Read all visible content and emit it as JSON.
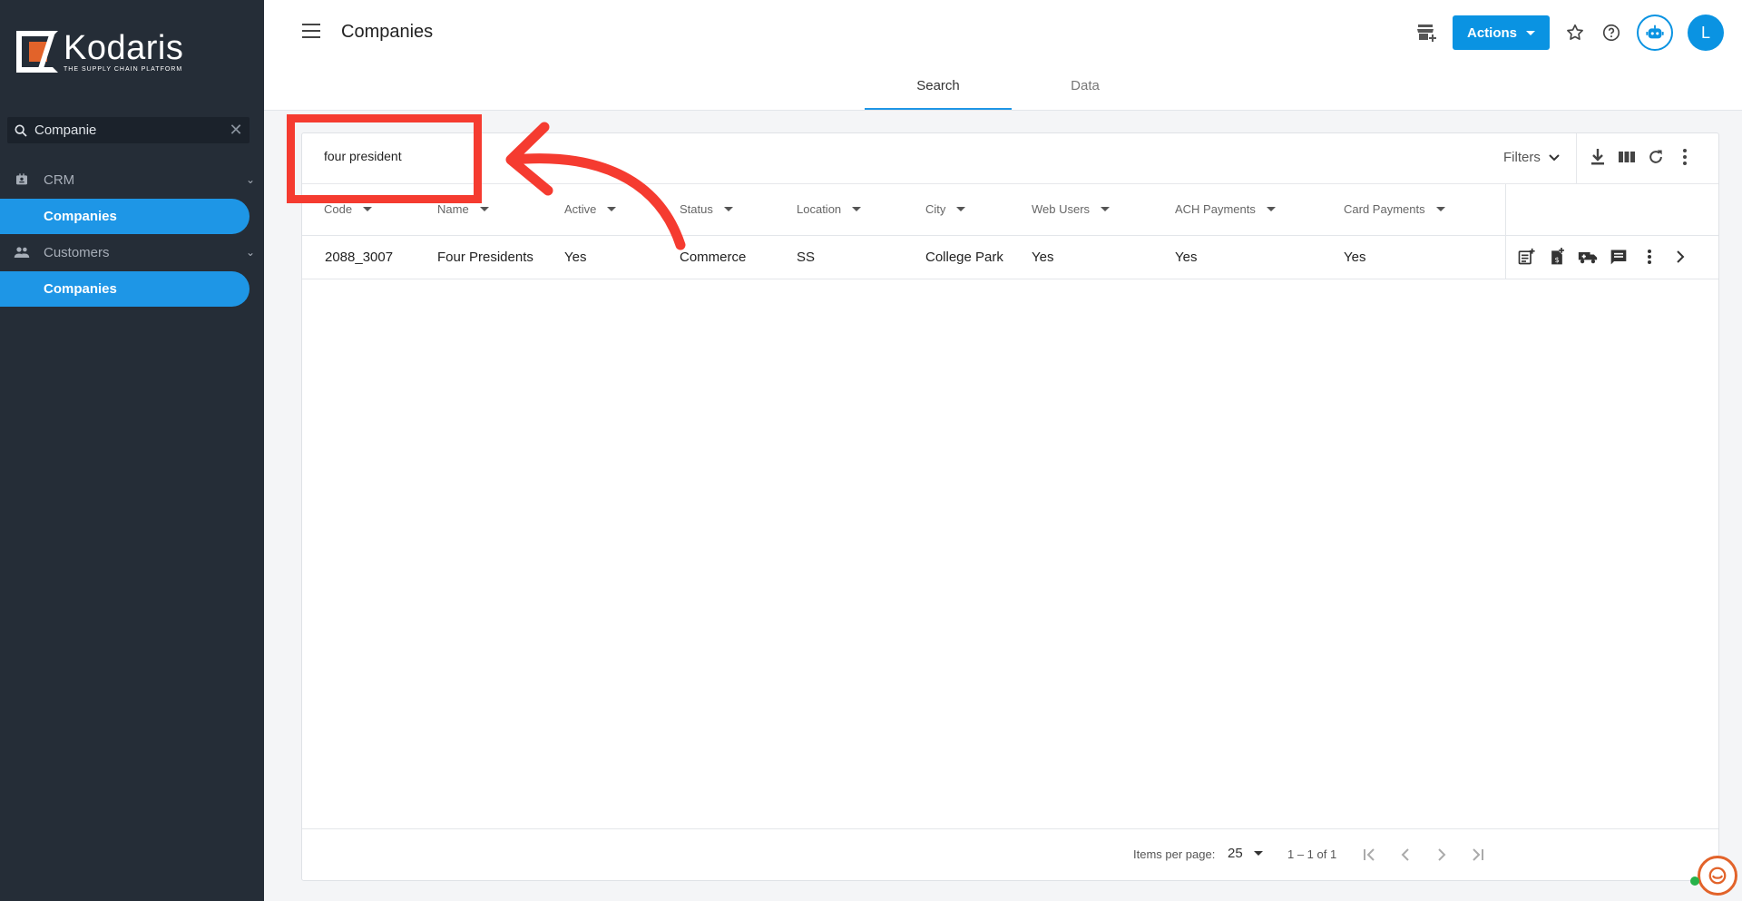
{
  "brand": {
    "name": "Kodaris",
    "tagline": "THE SUPPLY CHAIN PLATFORM",
    "accent": "#1e96e6",
    "logo_orange": "#e2632a"
  },
  "sidebar": {
    "search_value": "Companie",
    "groups": [
      {
        "label": "CRM",
        "icon": "contact-card-icon",
        "items": [
          {
            "label": "Companies"
          }
        ]
      },
      {
        "label": "Customers",
        "icon": "people-icon",
        "items": [
          {
            "label": "Companies"
          }
        ]
      }
    ]
  },
  "header": {
    "title": "Companies",
    "actions_label": "Actions",
    "avatar_initial": "L"
  },
  "tabs": [
    {
      "label": "Search",
      "active": true
    },
    {
      "label": "Data",
      "active": false
    }
  ],
  "search": {
    "value": "four president",
    "filters_label": "Filters"
  },
  "table": {
    "columns": [
      "Code",
      "Name",
      "Active",
      "Status",
      "Location",
      "City",
      "Web Users",
      "ACH Payments",
      "Card Payments"
    ],
    "rows": [
      [
        "2088_3007",
        "Four Presidents",
        "Yes",
        "Commerce",
        "SS",
        "College Park",
        "Yes",
        "Yes",
        "Yes"
      ]
    ]
  },
  "pagination": {
    "items_per_page_label": "Items per page:",
    "items_per_page": "25",
    "range": "1 – 1 of 1"
  },
  "annotation": {
    "color": "#f53b30"
  }
}
